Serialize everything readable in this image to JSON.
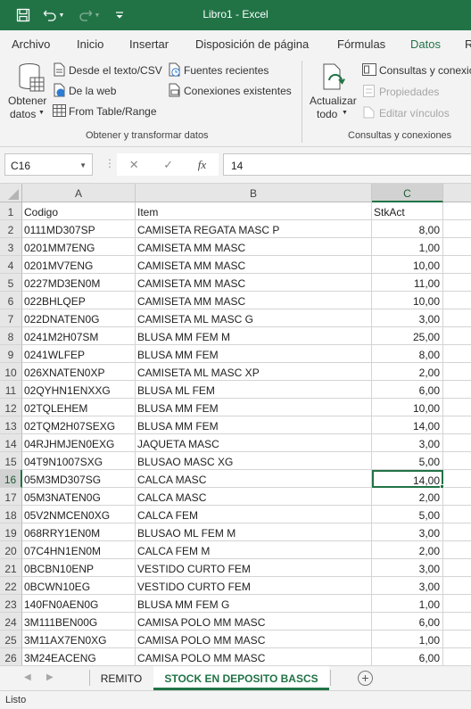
{
  "window": {
    "title": "Libro1  -  Excel"
  },
  "ribbon_tabs": [
    {
      "label": "Archivo",
      "active": false
    },
    {
      "label": "Inicio",
      "active": false
    },
    {
      "label": "Insertar",
      "active": false
    },
    {
      "label": "Disposición de página",
      "active": false
    },
    {
      "label": "Fórmulas",
      "active": false
    },
    {
      "label": "Datos",
      "active": true
    },
    {
      "label": "R",
      "active": false
    }
  ],
  "ribbon": {
    "get_data": {
      "line1": "Obtener",
      "line2": "datos"
    },
    "from_text": "Desde el texto/CSV",
    "from_web": "De la web",
    "from_table": "From Table/Range",
    "recent_sources": "Fuentes recientes",
    "existing_connections": "Conexiones existentes",
    "group1_label": "Obtener y transformar datos",
    "refresh": {
      "line1": "Actualizar",
      "line2": "todo"
    },
    "queries": "Consultas y conexiones",
    "properties": "Propiedades",
    "edit_links": "Editar vínculos",
    "group2_label": "Consultas y conexiones"
  },
  "formula_bar": {
    "name_box": "C16",
    "fx": "fx",
    "value": "14"
  },
  "sheet": {
    "columns": [
      "A",
      "B",
      "C"
    ],
    "selected_column": "C",
    "selected_row": 16,
    "rows": [
      {
        "n": "1",
        "a": "Codigo",
        "b": "Item",
        "c": "StkAct"
      },
      {
        "n": "2",
        "a": "0111MD307SP",
        "b": "CAMISETA REGATA MASC P",
        "c": "8,00"
      },
      {
        "n": "3",
        "a": "0201MM7ENG",
        "b": "CAMISETA MM MASC",
        "c": "1,00"
      },
      {
        "n": "4",
        "a": "0201MV7ENG",
        "b": "CAMISETA MM MASC",
        "c": "10,00"
      },
      {
        "n": "5",
        "a": "0227MD3EN0M",
        "b": "CAMISETA MM MASC",
        "c": "11,00"
      },
      {
        "n": "6",
        "a": "022BHLQEP",
        "b": "CAMISETA MM MASC",
        "c": "10,00"
      },
      {
        "n": "7",
        "a": "022DNATEN0G",
        "b": "CAMISETA ML MASC G",
        "c": "3,00"
      },
      {
        "n": "8",
        "a": "0241M2H07SM",
        "b": "BLUSA MM FEM M",
        "c": "25,00"
      },
      {
        "n": "9",
        "a": "0241WLFEP",
        "b": "BLUSA MM FEM",
        "c": "8,00"
      },
      {
        "n": "10",
        "a": "026XNATEN0XP",
        "b": "CAMISETA ML MASC XP",
        "c": "2,00"
      },
      {
        "n": "11",
        "a": "02QYHN1ENXXG",
        "b": "BLUSA ML FEM",
        "c": "6,00"
      },
      {
        "n": "12",
        "a": "02TQLEHEM",
        "b": "BLUSA MM FEM",
        "c": "10,00"
      },
      {
        "n": "13",
        "a": "02TQM2H07SEXG",
        "b": "BLUSA MM FEM",
        "c": "14,00"
      },
      {
        "n": "14",
        "a": "04RJHMJEN0EXG",
        "b": "JAQUETA MASC",
        "c": "3,00"
      },
      {
        "n": "15",
        "a": "04T9N1007SXG",
        "b": "BLUSAO MASC XG",
        "c": "5,00"
      },
      {
        "n": "16",
        "a": "05M3MD307SG",
        "b": "CALCA MASC",
        "c": "14,00"
      },
      {
        "n": "17",
        "a": "05M3NATEN0G",
        "b": "CALCA MASC",
        "c": "2,00"
      },
      {
        "n": "18",
        "a": "05V2NMCEN0XG",
        "b": "CALCA FEM",
        "c": "5,00"
      },
      {
        "n": "19",
        "a": "068RRY1EN0M",
        "b": "BLUSAO ML FEM M",
        "c": "3,00"
      },
      {
        "n": "20",
        "a": "07C4HN1EN0M",
        "b": "CALCA FEM M",
        "c": "2,00"
      },
      {
        "n": "21",
        "a": "0BCBN10ENP",
        "b": "VESTIDO CURTO FEM",
        "c": "3,00"
      },
      {
        "n": "22",
        "a": "0BCWN10EG",
        "b": "VESTIDO CURTO FEM",
        "c": "3,00"
      },
      {
        "n": "23",
        "a": "140FN0AEN0G",
        "b": "BLUSA MM FEM G",
        "c": "1,00"
      },
      {
        "n": "24",
        "a": "3M111BEN00G",
        "b": "CAMISA POLO MM MASC",
        "c": "6,00"
      },
      {
        "n": "25",
        "a": "3M11AX7EN0XG",
        "b": "CAMISA POLO MM MASC",
        "c": "1,00"
      },
      {
        "n": "26",
        "a": "3M24EACENG",
        "b": "CAMISA POLO MM MASC",
        "c": "6,00"
      }
    ]
  },
  "sheet_tabs": [
    {
      "label": "REMITO",
      "active": false
    },
    {
      "label": "STOCK EN DEPOSITO BASCS",
      "active": true
    }
  ],
  "status": "Listo"
}
